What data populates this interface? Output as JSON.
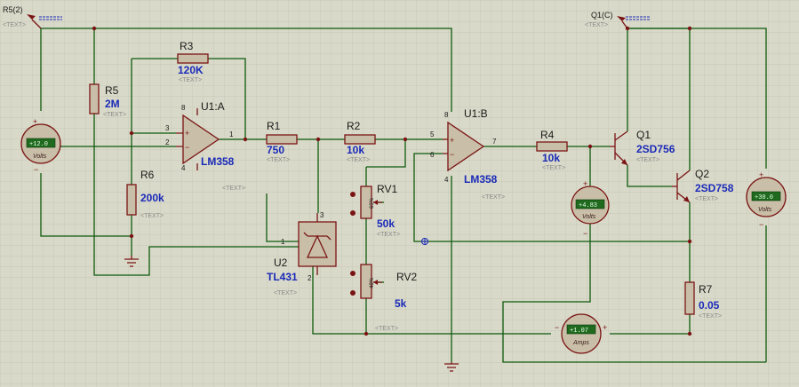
{
  "probes": {
    "left": {
      "label": "R5(2)",
      "text": "<TEXT>"
    },
    "right": {
      "label": "Q1(C)",
      "text": "<TEXT>"
    }
  },
  "text_placeholder": "<TEXT>",
  "components": {
    "R1": {
      "ref": "R1",
      "value": "750"
    },
    "R2": {
      "ref": "R2",
      "value": "10k"
    },
    "R3": {
      "ref": "R3",
      "value": "120K"
    },
    "R4": {
      "ref": "R4",
      "value": "10k"
    },
    "R5": {
      "ref": "R5",
      "value": "2M"
    },
    "R6": {
      "ref": "R6",
      "value": "200k"
    },
    "R7": {
      "ref": "R7",
      "value": "0.05"
    },
    "RV1": {
      "ref": "RV1",
      "value": "50k",
      "percent": "69%"
    },
    "RV2": {
      "ref": "RV2",
      "value": "5k",
      "percent": "48%"
    },
    "U1A": {
      "ref": "U1:A",
      "value": "LM358"
    },
    "U1B": {
      "ref": "U1:B",
      "value": "LM358"
    },
    "U2": {
      "ref": "U2",
      "value": "TL431"
    },
    "Q1": {
      "ref": "Q1",
      "value": "2SD756"
    },
    "Q2": {
      "ref": "Q2",
      "value": "2SD758"
    }
  },
  "pins": {
    "u1a_3": "3",
    "u1a_2": "2",
    "u1a_1": "1",
    "u1a_8": "8",
    "u1a_4": "4",
    "u1b_5": "5",
    "u1b_6": "6",
    "u1b_7": "7",
    "u1b_8": "8",
    "u1b_4": "4",
    "u2_1": "1",
    "u2_2": "2",
    "u2_3": "3"
  },
  "meters": {
    "vin": {
      "reading": "+12.0",
      "unit": "Volts"
    },
    "vmid": {
      "reading": "+4.83",
      "unit": "Volts"
    },
    "vsupply": {
      "reading": "+30.0",
      "unit": "Volts"
    },
    "amps": {
      "reading": "+1.07",
      "unit": "Amps"
    }
  },
  "colors": {
    "background": "#d9d9c9",
    "wire": "#0d5a0d",
    "component": "#7a1414",
    "value_text": "#1a2ab8",
    "meter_body": "#c9bfa8",
    "meter_display": "#1f6a1f"
  }
}
